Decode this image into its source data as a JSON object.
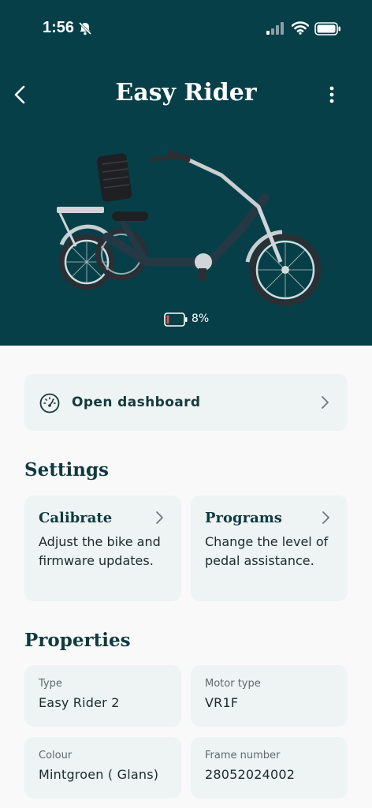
{
  "status_bar": {
    "time": "1:56"
  },
  "header": {
    "title": "Easy Rider"
  },
  "bike": {
    "battery_text": "8%",
    "battery_level": 0.08
  },
  "dashboard": {
    "label": "Open dashboard"
  },
  "settings": {
    "title": "Settings",
    "items": [
      {
        "title": "Calibrate",
        "description": "Adjust the bike and firmware updates."
      },
      {
        "title": "Programs",
        "description": "Change the level of pedal assistance."
      }
    ]
  },
  "properties": {
    "title": "Properties",
    "items": [
      {
        "label": "Type",
        "value": "Easy Rider 2"
      },
      {
        "label": "Motor type",
        "value": "VR1F"
      },
      {
        "label": "Colour",
        "value": "Mintgroen ( Glans)"
      },
      {
        "label": "Frame number",
        "value": "28052024002"
      }
    ]
  },
  "colors": {
    "header_bg": "#063f47",
    "card_bg": "#eef3f3",
    "heading": "#0f3a40",
    "battery_low": "#e0524a"
  },
  "icons": [
    "bell-off-icon",
    "signal-icon",
    "wifi-icon",
    "battery-icon",
    "back-chevron-icon",
    "more-vertical-icon",
    "speedometer-icon",
    "chevron-right-icon"
  ]
}
